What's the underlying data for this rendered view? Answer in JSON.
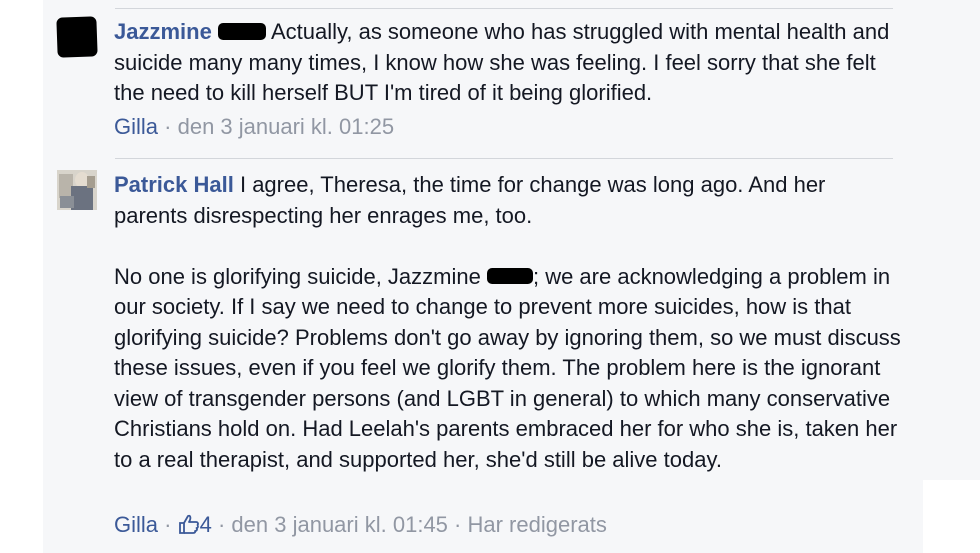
{
  "comments": [
    {
      "author": "Jazzmine",
      "paragraphs": [
        "Actually, as someone who has struggled with mental health and suicide many many times, I know how she was feeling. I feel sorry that she felt the need to kill herself BUT I'm tired of it being glorified."
      ],
      "like_label": "Gilla",
      "timestamp": "den 3 januari kl. 01:25"
    },
    {
      "author": "Patrick Hall",
      "paragraph1": "I agree, Theresa, the time for change was long ago. And her parents disrespecting her enrages me, too.",
      "paragraph2_before": "No one is glorifying suicide, Jazzmine",
      "paragraph2_after": "; we are acknowledging a problem in our society. If I say we need to change to prevent more suicides, how is that glorifying suicide? Problems don't go away by ignoring them, so we must discuss these issues, even if you feel we glorify them. The problem here is the ignorant view of transgender persons (and LGBT in general) to which many conservative Christians hold on. Had Leelah's parents embraced her for who she is, taken her to a real therapist, and supported her, she'd still be alive today.",
      "like_label": "Gilla",
      "like_count": "4",
      "timestamp": "den 3 januari kl. 01:45",
      "edited_label": "Har redigerats"
    }
  ],
  "separator": "·",
  "colors": {
    "link": "#3b5998",
    "text": "#141823",
    "meta": "#9197a3",
    "panel": "#f6f7f9"
  },
  "icons": {
    "like": "thumbs-up-icon"
  }
}
